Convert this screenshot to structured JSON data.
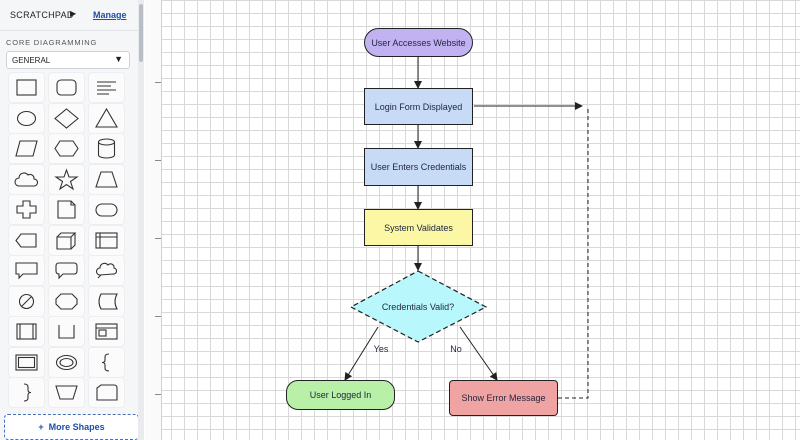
{
  "sidebar": {
    "scratchpad_label": "SCRATCHPAD",
    "scratchpad_arrow": "▶",
    "manage_label": "Manage",
    "section_label": "CORE DIAGRAMMING",
    "category": "GENERAL",
    "category_caret": "▼",
    "more_shapes_label": "More Shapes",
    "more_shapes_icon": "+",
    "shapes": [
      "rectangle",
      "rounded-rectangle",
      "text-block",
      "ellipse",
      "diamond",
      "triangle",
      "parallelogram",
      "hexagon",
      "cylinder",
      "cloud",
      "star",
      "trapezoid",
      "cross",
      "note",
      "stadium",
      "display",
      "cube",
      "internal-storage",
      "callout-rect",
      "callout-rounded",
      "callout-cloud",
      "prohibited",
      "process-hex",
      "stored-data",
      "subprocess",
      "bracket-open",
      "window",
      "double-rect",
      "double-ellipse",
      "curly-brace-left",
      "curly-brace-right",
      "manual-operation",
      "delay"
    ]
  },
  "diagram": {
    "nodes": {
      "start": {
        "label": "User Accesses Website",
        "fill": "#c3b2f2"
      },
      "login": {
        "label": "Login Form Displayed",
        "fill": "#c7dbf7"
      },
      "creds": {
        "label": "User Enters Credentials",
        "fill": "#c7dbf7"
      },
      "validate": {
        "label": "System Validates",
        "fill": "#fbf7a4"
      },
      "decision": {
        "label": "Credentials Valid?",
        "fill": "#b8f7fb"
      },
      "success": {
        "label": "User Logged In",
        "fill": "#b9f0a8"
      },
      "error": {
        "label": "Show Error Message",
        "fill": "#f0a3a3"
      }
    },
    "edge_labels": {
      "yes": "Yes",
      "no": "No"
    }
  }
}
